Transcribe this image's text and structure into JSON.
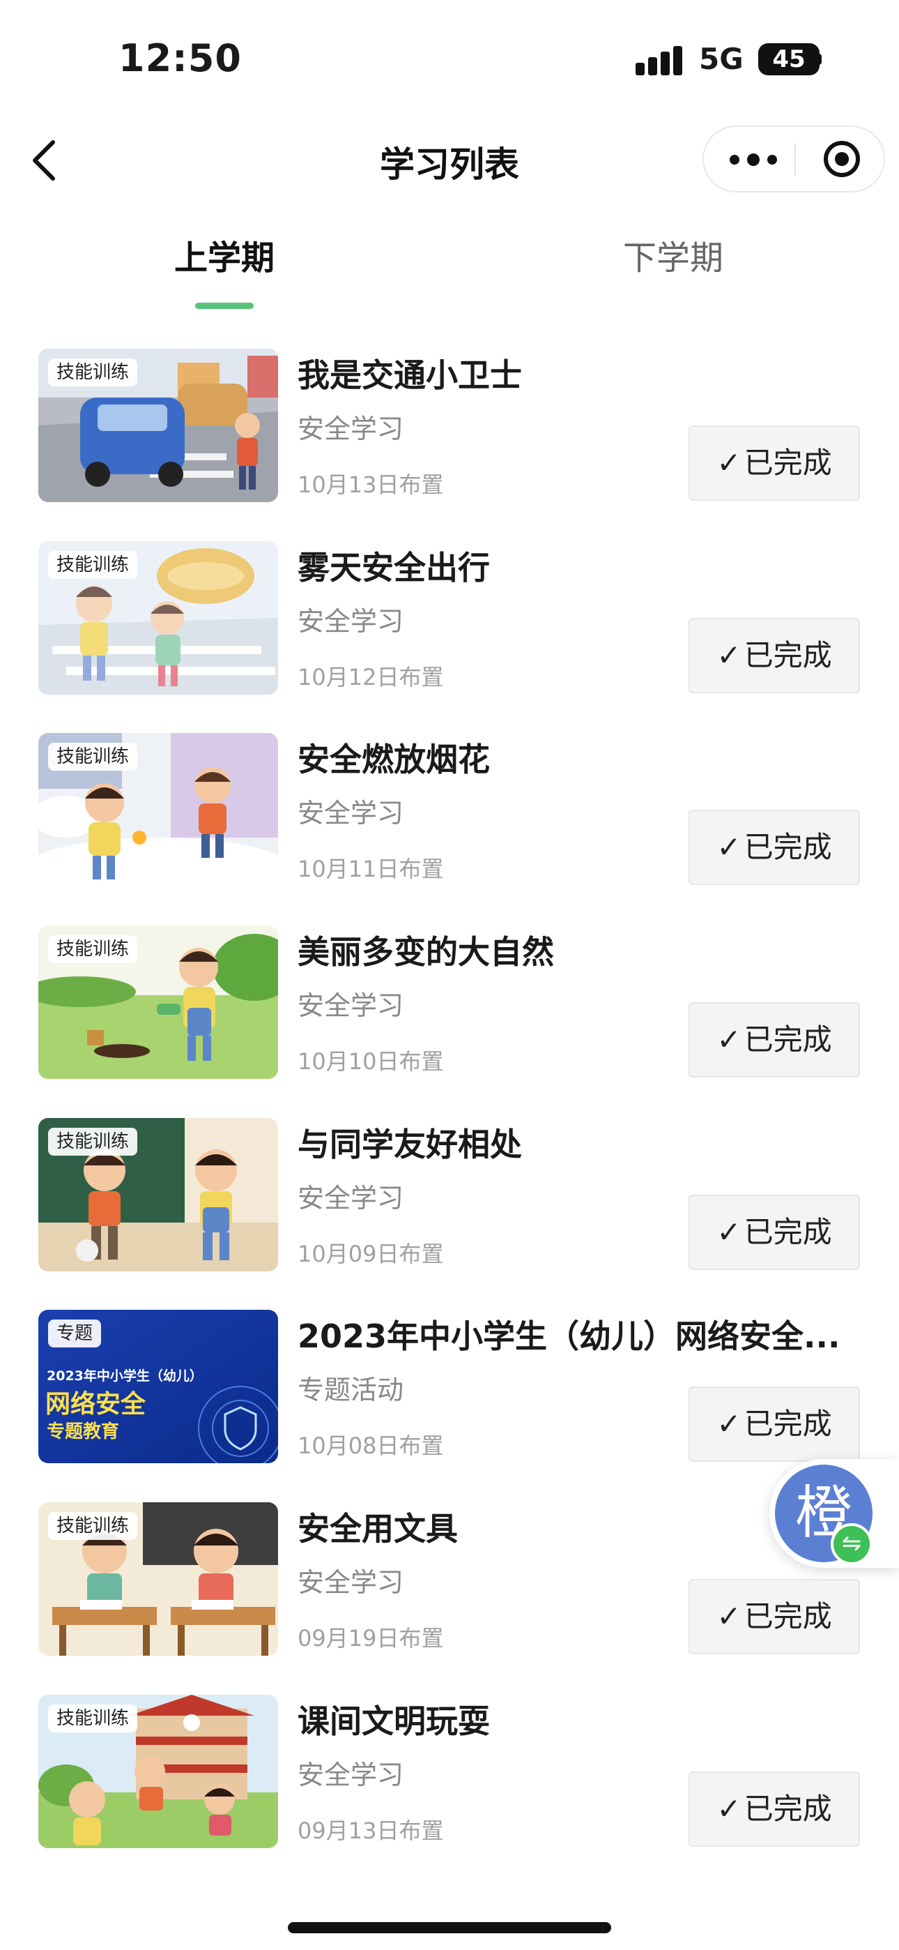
{
  "status_bar": {
    "time": "12:50",
    "network": "5G",
    "battery": "45"
  },
  "nav": {
    "title": "学习列表"
  },
  "tabs": [
    {
      "label": "上学期",
      "active": true
    },
    {
      "label": "下学期",
      "active": false
    }
  ],
  "items": [
    {
      "tag": "技能训练",
      "title": "我是交通小卫士",
      "category": "安全学习",
      "date": "10月13日布置",
      "status": "已完成",
      "thumb_icon": "traffic-scene-thumbnail"
    },
    {
      "tag": "技能训练",
      "title": "雾天安全出行",
      "category": "安全学习",
      "date": "10月12日布置",
      "status": "已完成",
      "thumb_icon": "foggy-crossing-thumbnail"
    },
    {
      "tag": "技能训练",
      "title": "安全燃放烟花",
      "category": "安全学习",
      "date": "10月11日布置",
      "status": "已完成",
      "thumb_icon": "fireworks-thumbnail"
    },
    {
      "tag": "技能训练",
      "title": "美丽多变的大自然",
      "category": "安全学习",
      "date": "10月10日布置",
      "status": "已完成",
      "thumb_icon": "nature-thumbnail"
    },
    {
      "tag": "技能训练",
      "title": "与同学友好相处",
      "category": "安全学习",
      "date": "10月09日布置",
      "status": "已完成",
      "thumb_icon": "classmates-thumbnail"
    },
    {
      "tag": "专题",
      "title": "2023年中小学生（幼儿）网络安全...",
      "category": "专题活动",
      "date": "10月08日布置",
      "status": "已完成",
      "thumb_icon": "network-security-thumbnail",
      "thumb_text": [
        "2023年中小学生（幼儿）",
        "网络安全",
        "专题教育"
      ]
    },
    {
      "tag": "技能训练",
      "title": "安全用文具",
      "category": "安全学习",
      "date": "09月19日布置",
      "status": "已完成",
      "thumb_icon": "stationery-thumbnail"
    },
    {
      "tag": "技能训练",
      "title": "课间文明玩耍",
      "category": "安全学习",
      "date": "09月13日布置",
      "status": "已完成",
      "thumb_icon": "recess-play-thumbnail"
    }
  ],
  "floating_button": {
    "label": "橙",
    "badge": "⇋"
  },
  "colors": {
    "accent_green": "#58c37a",
    "float_blue": "#5b7fd3",
    "badge_green": "#3fbf58"
  }
}
